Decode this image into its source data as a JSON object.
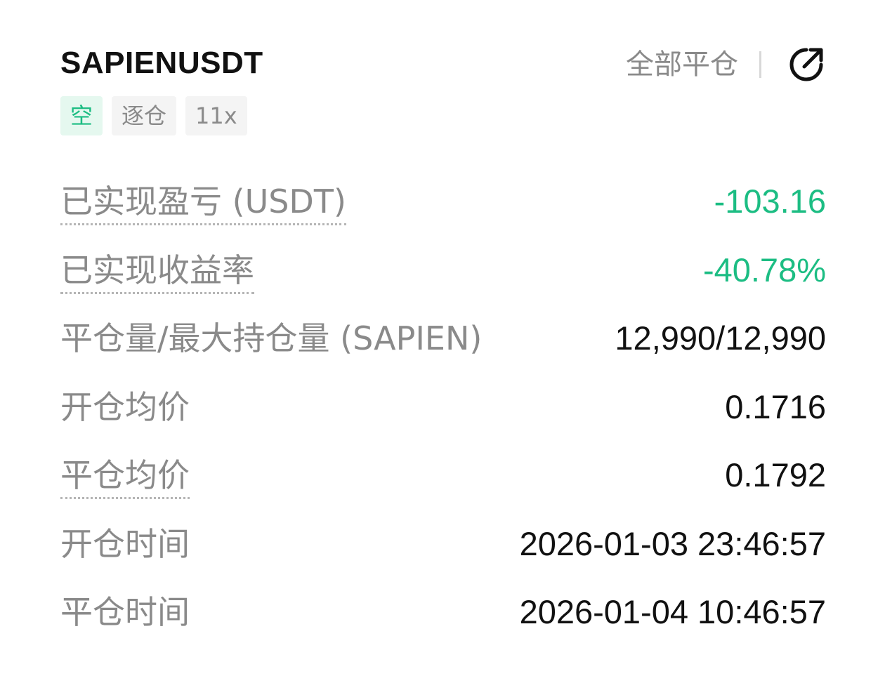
{
  "position": {
    "symbol": "SAPIENUSDT",
    "close_all_label": "全部平仓",
    "share_icon": "share-arrow-icon",
    "tags": {
      "side": "空",
      "margin_mode": "逐仓",
      "leverage": "11x"
    }
  },
  "details": {
    "realized_pnl": {
      "label": "已实现盈亏 (USDT)",
      "value": "-103.16"
    },
    "realized_roi": {
      "label": "已实现收益率",
      "value": "-40.78%"
    },
    "close_qty": {
      "label": "平仓量/最大持仓量 (SAPIEN)",
      "value": "12,990/12,990"
    },
    "open_avg_price": {
      "label": "开仓均价",
      "value": "0.1716"
    },
    "close_avg_price": {
      "label": "平仓均价",
      "value": "0.1792"
    },
    "open_time": {
      "label": "开仓时间",
      "value": "2026-01-03 23:46:57"
    },
    "close_time": {
      "label": "平仓时间",
      "value": "2026-01-04 10:46:57"
    }
  },
  "colors": {
    "profit_loss_green": "#1cbd83",
    "label_gray": "#8a8a8a",
    "text_dark": "#111111"
  }
}
